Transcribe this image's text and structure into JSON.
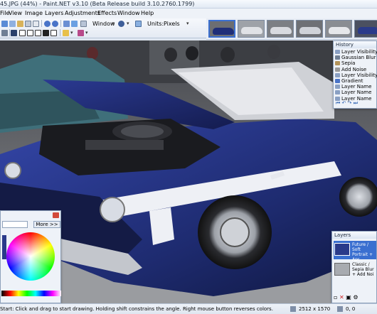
{
  "window": {
    "title": "45.JPG (44%) - Paint.NET v3.10 (Beta Release build 3.10.2760.1799)"
  },
  "menu": [
    "File",
    "View",
    "Image",
    "Layers",
    "Adjustments",
    "Effects",
    "Window",
    "Help"
  ],
  "toolbar": {
    "window_label": "Window",
    "units_label": "Units:",
    "units_value": "Pixels"
  },
  "history": {
    "title": "History",
    "items": [
      "Layer Visibility",
      "Gaussian Blur",
      "Sepia",
      "Add Noise",
      "Layer Visibility",
      "Gradient",
      "Layer Name",
      "Layer Name",
      "Layer Name"
    ]
  },
  "colors": {
    "more_button": "More >>"
  },
  "layers": {
    "title": "Layers",
    "items": [
      "Future / Soft Portrait + Apr Gradient",
      "Classic / Sepia Blur + Add Noi"
    ]
  },
  "status": {
    "hint": "Start: Click and drag to start drawing. Holding shift constrains the angle. Right mouse button reverses colors.",
    "size": "2512 x 1570",
    "coords": "0, 0"
  },
  "accent_colors": {
    "car_blue": "#1f2e78",
    "stripe": "#eef0f5",
    "selection": "#3a6fd0",
    "panel": "#eef2f8"
  }
}
